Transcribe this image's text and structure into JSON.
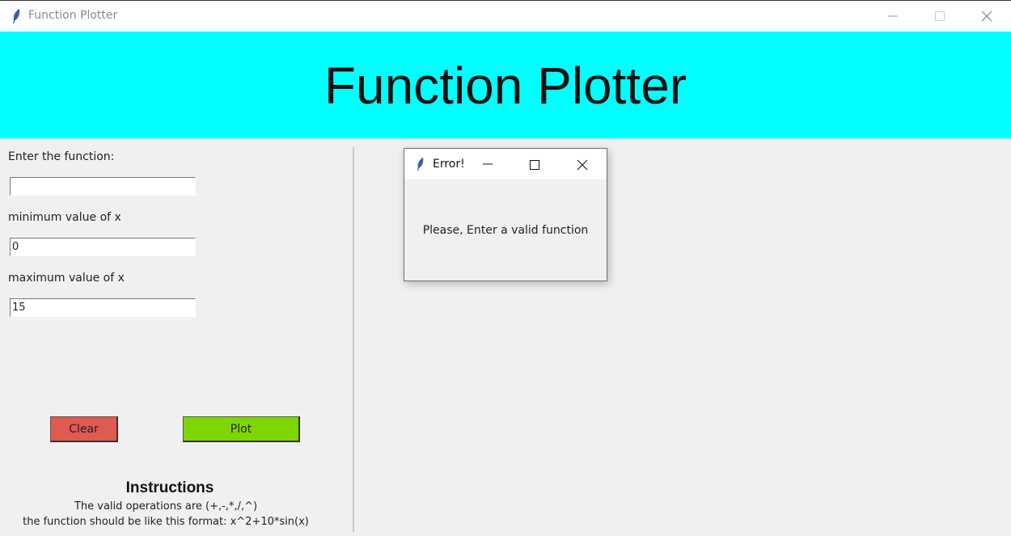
{
  "window": {
    "title": "Function Plotter",
    "icon": "feather-icon"
  },
  "banner": {
    "title": "Function Plotter",
    "background": "#00ffff"
  },
  "form": {
    "function_label": "Enter the function:",
    "function_value": "",
    "min_label": "minimum value of x",
    "min_value": "0",
    "max_label": "maximum value of x",
    "max_value": "15"
  },
  "buttons": {
    "clear_label": "Clear",
    "clear_color": "#e05a4f",
    "plot_label": "Plot",
    "plot_color": "#7ed600"
  },
  "instructions": {
    "title": "Instructions",
    "line1": "The valid operations are (+,-,*,/,^)",
    "line2": "the function should be like this format: x^2+10*sin(x)"
  },
  "dialog": {
    "title": "Error!",
    "message": "Please, Enter a valid function"
  }
}
